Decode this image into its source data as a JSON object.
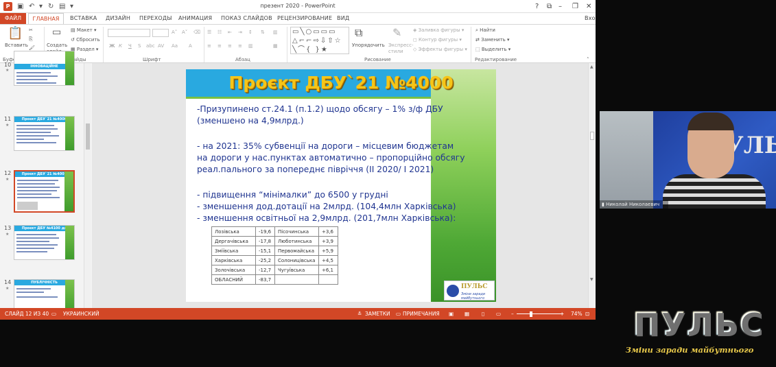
{
  "window": {
    "title": "презент 2020 - PowerPoint",
    "app_icon": "P",
    "signin": "Вход"
  },
  "tabs": {
    "file": "ФАЙЛ",
    "items": [
      "ГЛАВНАЯ",
      "ВСТАВКА",
      "ДИЗАЙН",
      "ПЕРЕХОДЫ",
      "АНИМАЦИЯ",
      "ПОКАЗ СЛАЙДОВ",
      "РЕЦЕНЗИРОВАНИЕ",
      "ВИД"
    ],
    "active": "ГЛАВНАЯ"
  },
  "ribbon": {
    "paste": "Вставить",
    "create_slide": "Создать слайд",
    "layout": "Макет",
    "reset": "Сбросить",
    "section": "Раздел",
    "arrange": "Упорядочить",
    "quick_styles": "Экспресс-стили",
    "shape_fill": "Заливка фигуры",
    "shape_outline": "Контур фигуры",
    "shape_effects": "Эффекты фигуры",
    "find": "Найти",
    "replace": "Заменить",
    "select": "Выделить",
    "groups": {
      "clipboard": "Буфер обмена",
      "slides": "Слайды",
      "font": "Шрифт",
      "paragraph": "Абзац",
      "drawing": "Рисование",
      "editing": "Редактирование"
    }
  },
  "thumbnails": [
    {
      "num": "10",
      "title": "ІННОВАЦІЙНЕ ФІНАНСУВАННЯ"
    },
    {
      "num": "11",
      "title": "Проєкт ДБУ`21 №4000"
    },
    {
      "num": "12",
      "title": "Проєкт ДБУ`21 №4000",
      "selected": true
    },
    {
      "num": "13",
      "title": "Проєкт ДБУ №4100 до"
    },
    {
      "num": "14",
      "title": "ПУБЛІЧНІСТЬ"
    }
  ],
  "slide": {
    "heading": "Проєкт ДБУ`21 №4000",
    "lines": [
      "-Призупинено ст.24.1 (п.1.2) щодо обсягу – 1% з/ф ДБУ",
      "(зменшено на 4,9млрд.)",
      "- на 2021: 35% субвенції на дороги – місцевим бюджетам",
      "на дороги у нас.пунктах автоматично – пропорційно обсягу",
      "реал.пального за попереднє півріччя (II 2020/ I 2021)",
      "- підвищення “мінімалки” до 6500 у грудні",
      "- зменшення дод.дотації на 2млрд. (104,4млн Харківська)",
      " - зменшення освітньої на 2,9млрд. (201,7млн Харківська):"
    ],
    "table": [
      [
        "Лозівська",
        "-19,6",
        "Пісочинська",
        "+3,6"
      ],
      [
        "Дергачівська",
        "-17,8",
        "Люботинська",
        "+3,9"
      ],
      [
        "Зміївська",
        "-15,1",
        "Первомайська",
        "+5,9"
      ],
      [
        "Харківська",
        "-25,2",
        "Солоницівська",
        "+4,5"
      ],
      [
        "Золочівська",
        "-12,7",
        "Чугуївська",
        "+6,1"
      ],
      [
        "ОБЛАСНИЙ",
        "-83,7",
        "",
        ""
      ]
    ],
    "logo_title": "ПУЛЬС",
    "logo_sub": "Зміни заради майбутнього"
  },
  "status": {
    "slide_counter": "СЛАЙД 12 ИЗ 40",
    "language": "УКРАИНСКИЙ",
    "notes": "ЗАМЕТКИ",
    "comments": "ПРИМЕЧАНИЯ",
    "zoom": "74%"
  },
  "camera": {
    "name": "Николай Николаевич",
    "banner_text": "ПУЛЬС"
  },
  "brand": {
    "word": "ПУЛЬС",
    "slogan": "Зміни заради майбутнього"
  },
  "colors": {
    "accent": "#d24726",
    "slide_band": "#29a9e0",
    "slide_text": "#1f3490",
    "heading": "#f5c518"
  }
}
